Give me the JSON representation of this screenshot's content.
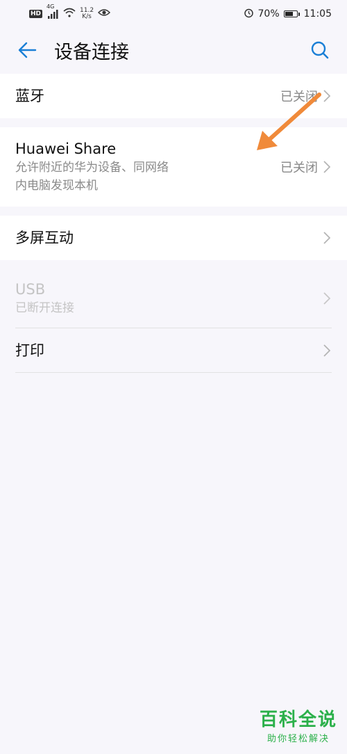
{
  "status_bar": {
    "hd": "HD",
    "net_type": "4G",
    "speed_value": "11.2",
    "speed_unit": "K/s",
    "battery_percent": "70%",
    "battery_level": 0.7,
    "time": "11:05",
    "icons": [
      "signal-icon",
      "wifi-icon",
      "eye-icon",
      "alarm-icon",
      "battery-icon"
    ]
  },
  "header": {
    "title": "设备连接",
    "back_icon": "back-arrow-icon",
    "search_icon": "search-icon"
  },
  "colors": {
    "accent": "#1a7fd6",
    "annotation": "#f08a3a",
    "watermark": "#2bb04a"
  },
  "items": {
    "bluetooth": {
      "title": "蓝牙",
      "value": "已关闭"
    },
    "huawei_share": {
      "title": "Huawei Share",
      "subtitle_line1": "允许附近的华为设备、同网络",
      "subtitle_line2": "内电脑发现本机",
      "value": "已关闭"
    },
    "multiscreen": {
      "title": "多屏互动"
    },
    "usb": {
      "title": "USB",
      "subtitle": "已断开连接"
    },
    "print": {
      "title": "打印"
    }
  },
  "watermark": {
    "title": "百科全说",
    "subtitle": "助你轻松解决"
  }
}
